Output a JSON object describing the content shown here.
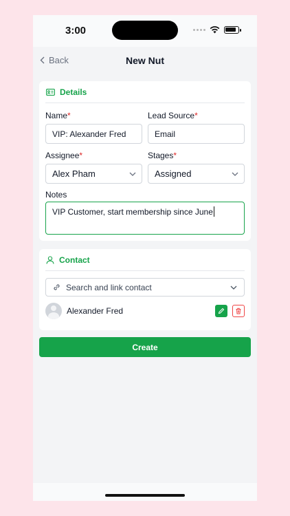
{
  "status_bar": {
    "time": "3:00"
  },
  "nav": {
    "back_label": "Back",
    "title": "New Nut"
  },
  "details": {
    "heading": "Details",
    "name": {
      "label": "Name",
      "value": "VIP: Alexander Fred"
    },
    "lead_source": {
      "label": "Lead Source",
      "value": "Email"
    },
    "assignee": {
      "label": "Assignee",
      "value": "Alex Pham"
    },
    "stages": {
      "label": "Stages",
      "value": "Assigned"
    },
    "notes": {
      "label": "Notes",
      "value": "VIP Customer, start membership since June"
    },
    "required_mark": "*"
  },
  "contact": {
    "heading": "Contact",
    "search_placeholder": "Search and link contact",
    "linked": [
      {
        "name": "Alexander Fred"
      }
    ]
  },
  "actions": {
    "create_label": "Create"
  },
  "colors": {
    "accent": "#16a34a",
    "danger": "#ef4444",
    "background": "#fde4ea"
  }
}
